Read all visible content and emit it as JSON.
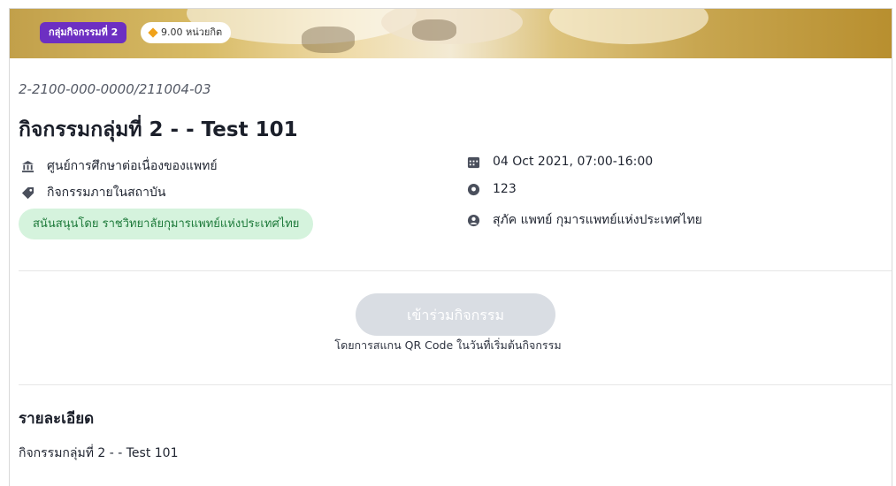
{
  "banner": {
    "group_tag": "กลุ่มกิจกรรมที่ 2",
    "credit_tag": "9.00 หน่วยกิต",
    "group_tag_color": "#6d2fc2",
    "credit_icon": "diamond-icon"
  },
  "activity": {
    "code": "2-2100-000-0000/211004-03",
    "title": "กิจกรรมกลุ่มที่ 2 - - Test 101",
    "organizer": "ศูนย์การศึกษาต่อเนื่องของแพทย์",
    "category": "กิจกรรมภายในสถาบัน",
    "sponsor": "สนันสนุนโดย ราชวิทยาลัยกุมารแพทย์แห่งประเทศไทย",
    "datetime": "04 Oct 2021, 07:00-16:00",
    "location": "123",
    "speaker": "สุภัค แพทย์ กุมารแพทย์แห่งประเทศไทย"
  },
  "join": {
    "button_label": "เข้าร่วมกิจกรรม",
    "note": "โดยการสแกน QR Code ในวันที่เริ่มต้นกิจกรรม"
  },
  "details": {
    "heading": "รายละเอียด",
    "body": "กิจกรรมกลุ่มที่ 2 - - Test 101"
  },
  "icons": {
    "organizer": "institution-icon",
    "category": "tag-icon",
    "datetime": "calendar-icon",
    "location": "location-pin-icon",
    "speaker": "user-circle-icon"
  },
  "colors": {
    "sponsor_bg": "#d5f3dd",
    "sponsor_text": "#1d7a3a",
    "button_disabled": "#d9dde3"
  }
}
